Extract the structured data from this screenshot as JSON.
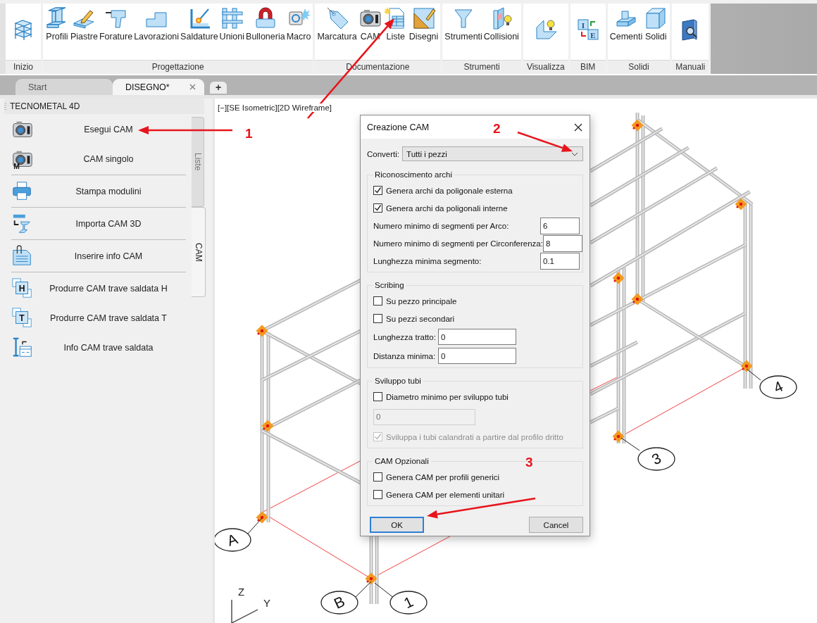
{
  "ribbon": {
    "groups": [
      {
        "label": "Inizio",
        "buttons": [
          {
            "kind": "icon"
          }
        ]
      },
      {
        "label": "Progettazione",
        "buttons": [
          {
            "kind": "labeled",
            "label": "Profili"
          },
          {
            "kind": "labeled",
            "label": "Piastre"
          },
          {
            "kind": "labeled",
            "label": "Forature"
          },
          {
            "kind": "labeled",
            "label": "Lavorazioni"
          },
          {
            "kind": "labeled",
            "label": "Saldature"
          },
          {
            "kind": "labeled",
            "label": "Unioni"
          },
          {
            "kind": "labeled",
            "label": "Bulloneria"
          },
          {
            "kind": "labeled",
            "label": "Macro"
          }
        ]
      },
      {
        "label": "Documentazione",
        "buttons": [
          {
            "kind": "labeled",
            "label": "Marcatura"
          },
          {
            "kind": "labeled",
            "label": "CAM"
          },
          {
            "kind": "labeled",
            "label": "Liste"
          },
          {
            "kind": "labeled",
            "label": "Disegni"
          }
        ]
      },
      {
        "label": "Strumenti",
        "buttons": [
          {
            "kind": "labeled",
            "label": "Strumenti"
          },
          {
            "kind": "labeled",
            "label": "Collisioni"
          }
        ]
      },
      {
        "label": "Visualizza",
        "buttons": [
          {
            "kind": "icon"
          }
        ]
      },
      {
        "label": "BIM",
        "buttons": [
          {
            "kind": "icon",
            "badges": [
              "I",
              "E"
            ]
          }
        ]
      },
      {
        "label": "Solidi",
        "buttons": [
          {
            "kind": "labeled",
            "label": "Cementi"
          },
          {
            "kind": "labeled",
            "label": "Solidi"
          }
        ]
      },
      {
        "label": "Manuali",
        "buttons": [
          {
            "kind": "icon"
          }
        ]
      }
    ]
  },
  "tabs": {
    "items": [
      {
        "label": "Start",
        "selected": false,
        "closable": false
      },
      {
        "label": "DISEGNO*",
        "selected": true,
        "closable": true
      }
    ],
    "new_tab": "+"
  },
  "panel": {
    "title": "TECNOMETAL 4D",
    "groups": [
      {
        "items": [
          {
            "label": "Esegui CAM"
          },
          {
            "label": "CAM singolo",
            "badge": "M"
          }
        ]
      },
      {
        "items": [
          {
            "label": "Stampa modulini"
          }
        ]
      },
      {
        "items": [
          {
            "label": "Importa CAM 3D"
          }
        ]
      },
      {
        "items": [
          {
            "label": "Inserire info CAM"
          }
        ]
      },
      {
        "items": [
          {
            "label": "Produrre CAM trave saldata H",
            "badge": "H"
          },
          {
            "label": "Produrre CAM trave saldata T",
            "badge": "T"
          },
          {
            "label": "Info CAM trave saldata"
          }
        ]
      }
    ],
    "side_tabs": [
      {
        "label": "Liste",
        "selected": false
      },
      {
        "label": "CAM",
        "selected": true
      }
    ]
  },
  "canvas": {
    "view_label": "[−][SE Isometric][2D Wireframe]",
    "grid_bubbles": [
      {
        "label": "A"
      },
      {
        "label": "B"
      },
      {
        "label": "1"
      },
      {
        "label": "3"
      },
      {
        "label": "4"
      }
    ],
    "axes": [
      {
        "label": "Z"
      },
      {
        "label": "Y"
      }
    ]
  },
  "dialog": {
    "title": "Creazione CAM",
    "convert": {
      "label": "Converti:",
      "value": "Tutti i pezzi"
    },
    "sections": [
      {
        "title": "Riconoscimento archi",
        "rows": [
          {
            "kind": "checkbox",
            "label": "Genera archi da poligonale esterna",
            "checked": true,
            "disabled": false
          },
          {
            "kind": "checkbox",
            "label": "Genera archi da poligonali interne",
            "checked": true,
            "disabled": false
          },
          {
            "kind": "number",
            "label": "Numero minimo di segmenti per Arco:",
            "value": "6",
            "disabled": false
          },
          {
            "kind": "number",
            "label": "Numero minimo di segmenti per Circonferenza:",
            "value": "8",
            "disabled": false
          },
          {
            "kind": "number",
            "label": "Lunghezza minima segmento:",
            "value": "0.1",
            "disabled": false
          }
        ]
      },
      {
        "title": "Scribing",
        "rows": [
          {
            "kind": "checkbox",
            "label": "Su pezzo principale",
            "checked": false,
            "disabled": false
          },
          {
            "kind": "checkbox",
            "label": "Su pezzi secondari",
            "checked": false,
            "disabled": false
          },
          {
            "kind": "entry",
            "label": "Lunghezza tratto:",
            "value": "0",
            "disabled": false
          },
          {
            "kind": "entry",
            "label": "Distanza minima:",
            "value": "0",
            "disabled": false
          }
        ]
      },
      {
        "title": "Sviluppo tubi",
        "rows": [
          {
            "kind": "checkbox",
            "label": "Diametro minimo per sviluppo tubi",
            "checked": false,
            "disabled": false
          },
          {
            "kind": "field",
            "value": "0",
            "disabled": true
          },
          {
            "kind": "checkbox",
            "label": "Sviluppa i tubi calandrati a partire dal profilo dritto",
            "checked": true,
            "disabled": true
          }
        ]
      },
      {
        "title": "CAM Opzionali",
        "rows": [
          {
            "kind": "checkbox",
            "label": "Genera CAM per profili generici",
            "checked": false,
            "disabled": false
          },
          {
            "kind": "checkbox",
            "label": "Genera CAM per elementi unitari",
            "checked": false,
            "disabled": false
          }
        ]
      }
    ],
    "buttons": [
      {
        "label": "OK",
        "default": true
      },
      {
        "label": "Cancel",
        "default": false
      }
    ]
  },
  "annotations": [
    {
      "label": "1"
    },
    {
      "label": "2"
    },
    {
      "label": "3"
    }
  ]
}
